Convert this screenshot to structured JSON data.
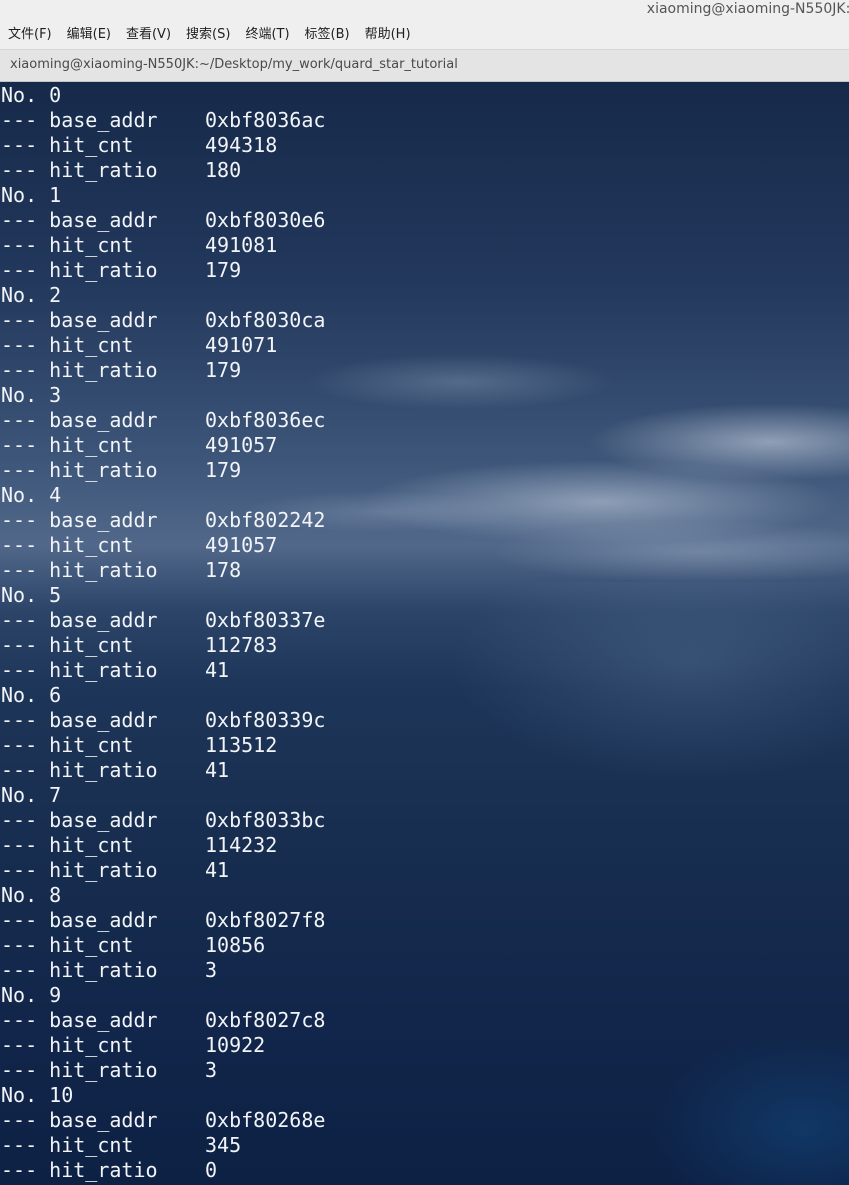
{
  "window": {
    "title": "xiaoming@xiaoming-N550JK:/",
    "tab_title": "xiaoming@xiaoming-N550JK:~/Desktop/my_work/quard_star_tutorial"
  },
  "menu": {
    "items": [
      "文件(F)",
      "编辑(E)",
      "查看(V)",
      "搜索(S)",
      "终端(T)",
      "标签(B)",
      "帮助(H)"
    ]
  },
  "terminal": {
    "entries": [
      {
        "header": "No. 0",
        "fields": [
          {
            "key": "--- base_addr",
            "value": "0xbf8036ac"
          },
          {
            "key": "--- hit_cnt",
            "value": "494318"
          },
          {
            "key": "--- hit_ratio",
            "value": "180"
          }
        ]
      },
      {
        "header": "No. 1",
        "fields": [
          {
            "key": "--- base_addr",
            "value": "0xbf8030e6"
          },
          {
            "key": "--- hit_cnt",
            "value": "491081"
          },
          {
            "key": "--- hit_ratio",
            "value": "179"
          }
        ]
      },
      {
        "header": "No. 2",
        "fields": [
          {
            "key": "--- base_addr",
            "value": "0xbf8030ca"
          },
          {
            "key": "--- hit_cnt",
            "value": "491071"
          },
          {
            "key": "--- hit_ratio",
            "value": "179"
          }
        ]
      },
      {
        "header": "No. 3",
        "fields": [
          {
            "key": "--- base_addr",
            "value": "0xbf8036ec"
          },
          {
            "key": "--- hit_cnt",
            "value": "491057"
          },
          {
            "key": "--- hit_ratio",
            "value": "179"
          }
        ]
      },
      {
        "header": "No. 4",
        "fields": [
          {
            "key": "--- base_addr",
            "value": "0xbf802242"
          },
          {
            "key": "--- hit_cnt",
            "value": "491057"
          },
          {
            "key": "--- hit_ratio",
            "value": "178"
          }
        ]
      },
      {
        "header": "No. 5",
        "fields": [
          {
            "key": "--- base_addr",
            "value": "0xbf80337e"
          },
          {
            "key": "--- hit_cnt",
            "value": "112783"
          },
          {
            "key": "--- hit_ratio",
            "value": "41"
          }
        ]
      },
      {
        "header": "No. 6",
        "fields": [
          {
            "key": "--- base_addr",
            "value": "0xbf80339c"
          },
          {
            "key": "--- hit_cnt",
            "value": "113512"
          },
          {
            "key": "--- hit_ratio",
            "value": "41"
          }
        ]
      },
      {
        "header": "No. 7",
        "fields": [
          {
            "key": "--- base_addr",
            "value": "0xbf8033bc"
          },
          {
            "key": "--- hit_cnt",
            "value": "114232"
          },
          {
            "key": "--- hit_ratio",
            "value": "41"
          }
        ]
      },
      {
        "header": "No. 8",
        "fields": [
          {
            "key": "--- base_addr",
            "value": "0xbf8027f8"
          },
          {
            "key": "--- hit_cnt",
            "value": "10856"
          },
          {
            "key": "--- hit_ratio",
            "value": "3"
          }
        ]
      },
      {
        "header": "No. 9",
        "fields": [
          {
            "key": "--- base_addr",
            "value": "0xbf8027c8"
          },
          {
            "key": "--- hit_cnt",
            "value": "10922"
          },
          {
            "key": "--- hit_ratio",
            "value": "3"
          }
        ]
      },
      {
        "header": "No. 10",
        "fields": [
          {
            "key": "--- base_addr",
            "value": "0xbf80268e"
          },
          {
            "key": "--- hit_cnt",
            "value": "345"
          },
          {
            "key": "--- hit_ratio",
            "value": "0"
          }
        ]
      }
    ]
  }
}
